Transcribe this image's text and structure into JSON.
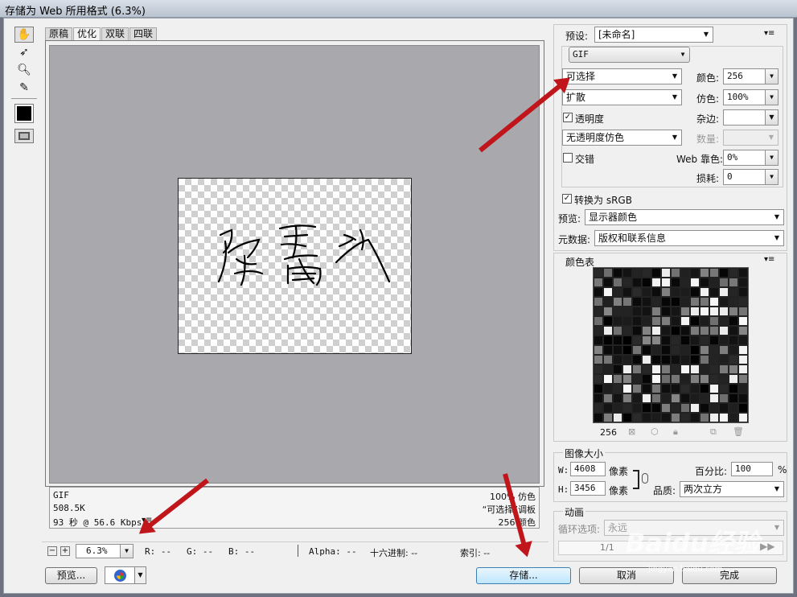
{
  "window": {
    "title": "存储为 Web 所用格式 (6.3%)"
  },
  "tools": [
    "hand-tool",
    "slice-select-tool",
    "zoom-tool",
    "eyedropper-tool",
    "eyedropper-color",
    "toggle-slices"
  ],
  "tabs": [
    "原稿",
    "优化",
    "双联",
    "四联"
  ],
  "info": {
    "format": "GIF",
    "size": "508.5K",
    "time": "93 秒 @ 56.6 Kbps",
    "dither": "100% 仿色",
    "palette": "“可选择”调板",
    "colors": "256 颜色",
    "menu_arrow": "▾≡"
  },
  "statusbar": {
    "zoom": "6.3%",
    "r": "R: --",
    "g": "G: --",
    "b": "B: --",
    "alpha": "Alpha: --",
    "hex": "十六进制: --",
    "index": "索引: --"
  },
  "buttons": {
    "preview": "预览...",
    "save": "存储...",
    "cancel": "取消",
    "done": "完成"
  },
  "right": {
    "preset_label": "预设:",
    "preset_value": "[未命名]",
    "format": "GIF",
    "reduction": "可选择",
    "colors_label": "颜色:",
    "colors_value": "256",
    "dither_algo": "扩散",
    "dither_label": "仿色:",
    "dither_value": "100%",
    "transparency_label": "透明度",
    "matte_label": "杂边:",
    "trans_dither": "无透明度仿色",
    "amount_label": "数量:",
    "interlaced_label": "交错",
    "websnap_label": "Web 靠色:",
    "websnap_value": "0%",
    "lossy_label": "损耗:",
    "lossy_value": "0",
    "srgb_label": "转换为 sRGB",
    "preview_label": "预览:",
    "preview_value": "显示器颜色",
    "metadata_label": "元数据:",
    "metadata_value": "版权和联系信息",
    "color_table_label": "颜色表",
    "color_count": "256",
    "image_size_label": "图像大小",
    "w_label": "W:",
    "w_value": "4608",
    "h_label": "H:",
    "h_value": "3456",
    "px": "像素",
    "percent_label": "百分比:",
    "percent_value": "100",
    "percent_sign": "%",
    "quality_label": "品质:",
    "quality_value": "两次立方",
    "animation_label": "动画",
    "loop_label": "循环选项:",
    "loop_value": "永远",
    "frame": "1/1"
  },
  "watermark": "Baidu经验",
  "watermark_url": "jingyan.baidu.com",
  "colors": {
    "arrow": "#c0151a",
    "canvas_gray": "#a9a8ad"
  }
}
